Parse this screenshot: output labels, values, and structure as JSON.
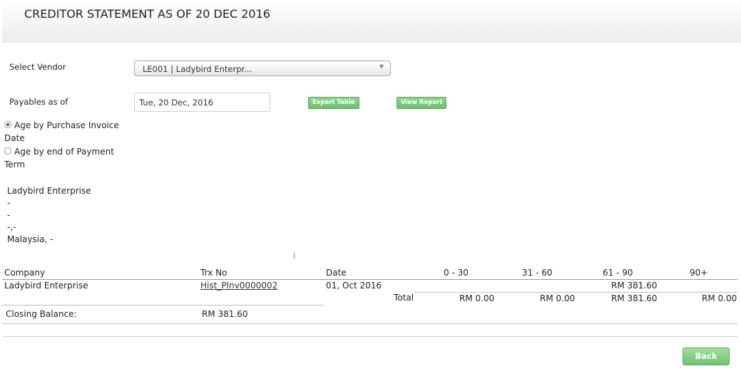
{
  "header": {
    "title": "CREDITOR STATEMENT AS OF 20 DEC 2016"
  },
  "vendor": {
    "label": "Select Vendor",
    "selected": "LE001 | Ladybird Enterpr..."
  },
  "payables": {
    "label": "Payables as of",
    "date_value": "Tue, 20 Dec, 2016",
    "export_label": "Export Table",
    "view_label": "View Report"
  },
  "aging": {
    "options": [
      {
        "line1": "Age by Purchase Invoice",
        "line2": "Date",
        "checked": true
      },
      {
        "line1": "Age by end of Payment",
        "line2": "Term",
        "checked": false
      }
    ]
  },
  "address": {
    "lines": [
      "Ladybird Enterprise",
      "-",
      "-",
      "-,-",
      "Malaysia, -"
    ]
  },
  "table": {
    "headers": {
      "company": "Company",
      "trx_no": "Trx No",
      "date": "Date",
      "b0_30": "0 - 30",
      "b31_60": "31 - 60",
      "b61_90": "61 - 90",
      "b90p": "90+"
    },
    "rows": [
      {
        "company": "Ladybird Enterprise",
        "trx_no": "Hist_PInv0000002",
        "date": "01, Oct 2016",
        "b61_90": "RM 381.60"
      }
    ],
    "totals": {
      "label": "Total",
      "b0_30": "RM 0.00",
      "b31_60": "RM 0.00",
      "b61_90": "RM 381.60",
      "b90p": "RM 0.00"
    },
    "closing": {
      "label": "Closing Balance:",
      "value": "RM 381.60"
    }
  },
  "footer": {
    "back_label": "Back"
  },
  "colors": {
    "accent_green": "#6cc06c"
  }
}
